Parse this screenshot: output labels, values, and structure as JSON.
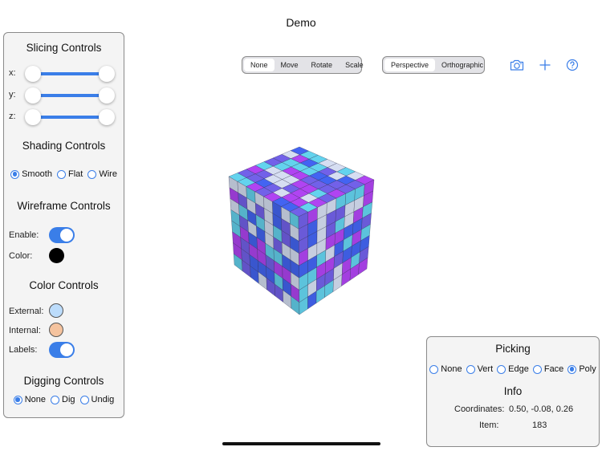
{
  "app": {
    "title": "Demo"
  },
  "slicing": {
    "title": "Slicing Controls",
    "axes": [
      {
        "label": "x:",
        "min_value": 0.0,
        "max_value": 1.0
      },
      {
        "label": "y:",
        "min_value": 0.0,
        "max_value": 1.0
      },
      {
        "label": "z:",
        "min_value": 0.0,
        "max_value": 1.0
      }
    ]
  },
  "shading": {
    "title": "Shading Controls",
    "options": [
      {
        "label": "Smooth",
        "selected": true
      },
      {
        "label": "Flat",
        "selected": false
      },
      {
        "label": "Wire",
        "selected": false
      }
    ]
  },
  "wireframe": {
    "title": "Wireframe Controls",
    "enable_label": "Enable:",
    "enable_on": true,
    "color_label": "Color:",
    "color": "#000000"
  },
  "color_controls": {
    "title": "Color Controls",
    "external_label": "External:",
    "external_color": "#bcdcfb",
    "internal_label": "Internal:",
    "internal_color": "#f5c39e",
    "labels_label": "Labels:",
    "labels_on": true
  },
  "digging": {
    "title": "Digging Controls",
    "options": [
      {
        "label": "None",
        "selected": true
      },
      {
        "label": "Dig",
        "selected": false
      },
      {
        "label": "Undig",
        "selected": false
      }
    ]
  },
  "toolbar": {
    "mode_segments": [
      {
        "label": "None",
        "selected": true
      },
      {
        "label": "Move",
        "selected": false
      },
      {
        "label": "Rotate",
        "selected": false
      },
      {
        "label": "Scale",
        "selected": false
      }
    ],
    "projection_segments": [
      {
        "label": "Perspective",
        "selected": true
      },
      {
        "label": "Orthographic",
        "selected": false
      }
    ],
    "icons": [
      "camera-icon",
      "plus-icon",
      "help-icon"
    ],
    "accent": "#3a7ee8"
  },
  "picking": {
    "title": "Picking",
    "options": [
      {
        "label": "None",
        "selected": false
      },
      {
        "label": "Vert",
        "selected": false
      },
      {
        "label": "Edge",
        "selected": false
      },
      {
        "label": "Face",
        "selected": false
      },
      {
        "label": "Poly",
        "selected": true
      }
    ],
    "info_title": "Info",
    "coordinates_label": "Coordinates:",
    "coordinates_value": "0.50, -0.08, 0.26",
    "item_label": "Item:",
    "item_value": "183"
  },
  "viewport": {
    "grid_size": 8,
    "palette": [
      "#3e5de0",
      "#6a5ad8",
      "#a33fe0",
      "#5cc3dc",
      "#c6cee0"
    ]
  }
}
